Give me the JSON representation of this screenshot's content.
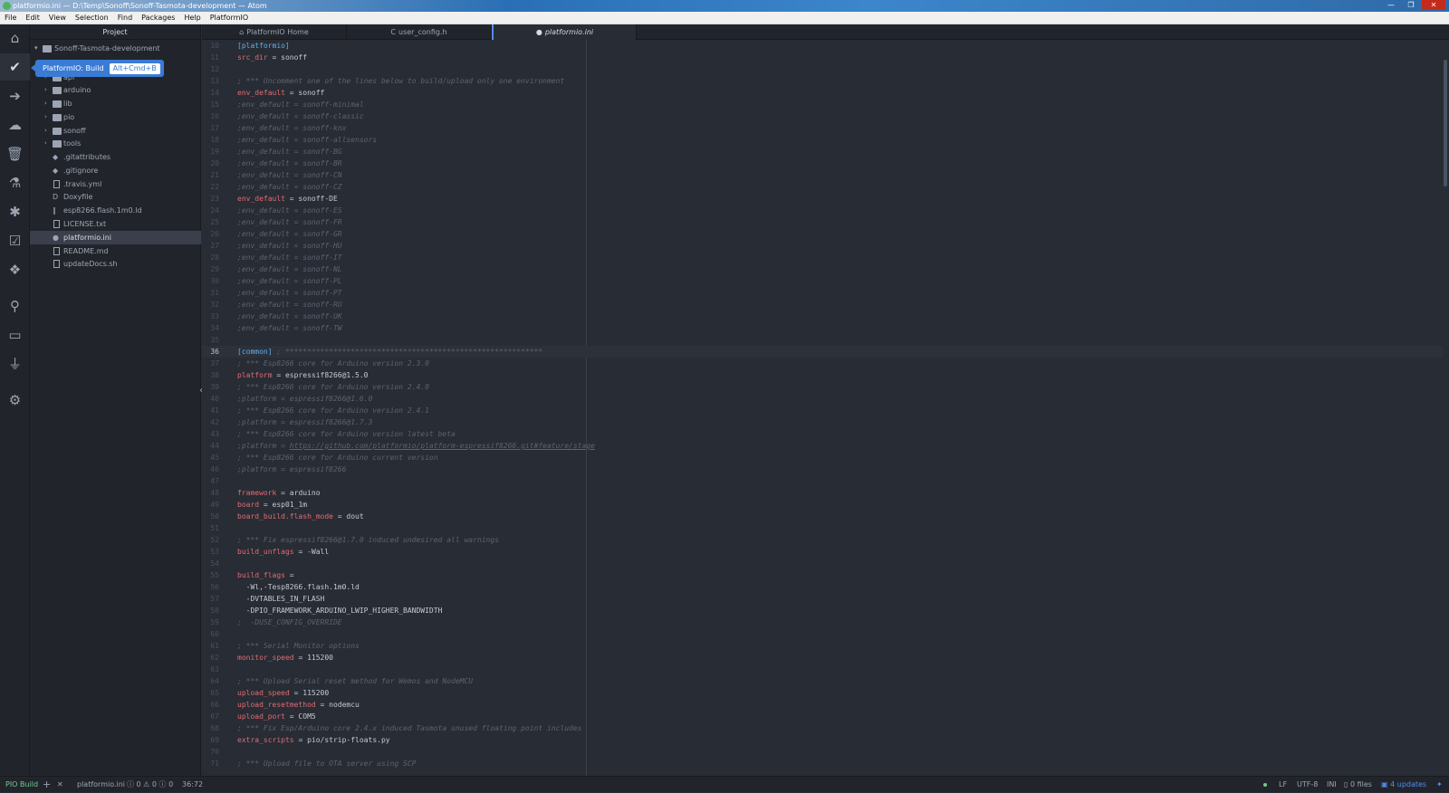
{
  "window": {
    "title": "platformio.ini — D:\\Temp\\Sonoff\\Sonoff-Tasmota-development — Atom",
    "controls": [
      "—",
      "❐",
      "✕"
    ]
  },
  "menu": [
    "File",
    "Edit",
    "View",
    "Selection",
    "Find",
    "Packages",
    "Help",
    "PlatformIO"
  ],
  "tooltip": {
    "label": "PlatformIO: Build",
    "shortcut": "Alt+Cmd+B"
  },
  "tree": {
    "header": "Project",
    "root": "Sonoff-Tasmota-development",
    "folders": [
      "api",
      "arduino",
      "lib",
      "pio",
      "sonoff",
      "tools"
    ],
    "files": [
      ".gitattributes",
      ".gitignore",
      ".travis.yml",
      "Doxyfile",
      "esp8266.flash.1m0.ld",
      "LICENSE.txt",
      "platformio.ini",
      "README.md",
      "updateDocs.sh"
    ]
  },
  "tabs": [
    {
      "label": "PlatformIO Home",
      "icon": "⌂"
    },
    {
      "label": "user_config.h",
      "icon": "C"
    },
    {
      "label": "platformio.ini",
      "icon": "●"
    }
  ],
  "editor": {
    "cursor_line": 36,
    "lines": [
      {
        "n": "10",
        "t": [
          [
            "sec",
            "[platformio]"
          ]
        ]
      },
      {
        "n": "11",
        "t": [
          [
            "key",
            "src_dir"
          ],
          [
            "val",
            " = sonoff"
          ]
        ]
      },
      {
        "n": "12",
        "t": []
      },
      {
        "n": "13",
        "t": [
          [
            "cmt",
            "; *** Uncomment one of the lines below to build/upload only one environment"
          ]
        ]
      },
      {
        "n": "14",
        "t": [
          [
            "key",
            "env_default"
          ],
          [
            "val",
            " = sonoff"
          ]
        ]
      },
      {
        "n": "15",
        "t": [
          [
            "cmt",
            ";env_default = sonoff-minimal"
          ]
        ]
      },
      {
        "n": "16",
        "t": [
          [
            "cmt",
            ";env_default = sonoff-classic"
          ]
        ]
      },
      {
        "n": "17",
        "t": [
          [
            "cmt",
            ";env_default = sonoff-knx"
          ]
        ]
      },
      {
        "n": "18",
        "t": [
          [
            "cmt",
            ";env_default = sonoff-allsensors"
          ]
        ]
      },
      {
        "n": "19",
        "t": [
          [
            "cmt",
            ";env_default = sonoff-BG"
          ]
        ]
      },
      {
        "n": "20",
        "t": [
          [
            "cmt",
            ";env_default = sonoff-BR"
          ]
        ]
      },
      {
        "n": "21",
        "t": [
          [
            "cmt",
            ";env_default = sonoff-CN"
          ]
        ]
      },
      {
        "n": "22",
        "t": [
          [
            "cmt",
            ";env_default = sonoff-CZ"
          ]
        ]
      },
      {
        "n": "23",
        "t": [
          [
            "key",
            "env_default"
          ],
          [
            "val",
            " = sonoff-DE"
          ]
        ]
      },
      {
        "n": "24",
        "t": [
          [
            "cmt",
            ";env_default = sonoff-ES"
          ]
        ]
      },
      {
        "n": "25",
        "t": [
          [
            "cmt",
            ";env_default = sonoff-FR"
          ]
        ]
      },
      {
        "n": "26",
        "t": [
          [
            "cmt",
            ";env_default = sonoff-GR"
          ]
        ]
      },
      {
        "n": "27",
        "t": [
          [
            "cmt",
            ";env_default = sonoff-HU"
          ]
        ]
      },
      {
        "n": "28",
        "t": [
          [
            "cmt",
            ";env_default = sonoff-IT"
          ]
        ]
      },
      {
        "n": "29",
        "t": [
          [
            "cmt",
            ";env_default = sonoff-NL"
          ]
        ]
      },
      {
        "n": "30",
        "t": [
          [
            "cmt",
            ";env_default = sonoff-PL"
          ]
        ]
      },
      {
        "n": "31",
        "t": [
          [
            "cmt",
            ";env_default = sonoff-PT"
          ]
        ]
      },
      {
        "n": "32",
        "t": [
          [
            "cmt",
            ";env_default = sonoff-RU"
          ]
        ]
      },
      {
        "n": "33",
        "t": [
          [
            "cmt",
            ";env_default = sonoff-UK"
          ]
        ]
      },
      {
        "n": "34",
        "t": [
          [
            "cmt",
            ";env_default = sonoff-TW"
          ]
        ]
      },
      {
        "n": "35",
        "t": []
      },
      {
        "n": "36",
        "t": [
          [
            "sec",
            "[common]"
          ],
          [
            "cmt",
            " ; ***********************************************************"
          ]
        ]
      },
      {
        "n": "37",
        "t": [
          [
            "cmt",
            "; *** Esp8266 core for Arduino version 2.3.0"
          ]
        ]
      },
      {
        "n": "38",
        "t": [
          [
            "key",
            "platform"
          ],
          [
            "val",
            " = espressif8266@1.5.0"
          ]
        ]
      },
      {
        "n": "39",
        "t": [
          [
            "cmt",
            "; *** Esp8266 core for Arduino version 2.4.0"
          ]
        ]
      },
      {
        "n": "40",
        "t": [
          [
            "cmt",
            ";platform = espressif8266@1.6.0"
          ]
        ]
      },
      {
        "n": "41",
        "t": [
          [
            "cmt",
            "; *** Esp8266 core for Arduino version 2.4.1"
          ]
        ]
      },
      {
        "n": "42",
        "t": [
          [
            "cmt",
            ";platform = espressif8266@1.7.3"
          ]
        ]
      },
      {
        "n": "43",
        "t": [
          [
            "cmt",
            "; *** Esp8266 core for Arduino version latest beta"
          ]
        ]
      },
      {
        "n": "44",
        "t": [
          [
            "cmt",
            ";platform = "
          ],
          [
            "link",
            "https://github.com/platformio/platform-espressif8266.git#feature/stage"
          ]
        ]
      },
      {
        "n": "45",
        "t": [
          [
            "cmt",
            "; *** Esp8266 core for Arduino current version"
          ]
        ]
      },
      {
        "n": "46",
        "t": [
          [
            "cmt",
            ";platform = espressif8266"
          ]
        ]
      },
      {
        "n": "47",
        "t": []
      },
      {
        "n": "48",
        "t": [
          [
            "key",
            "framework"
          ],
          [
            "val",
            " = arduino"
          ]
        ]
      },
      {
        "n": "49",
        "t": [
          [
            "key",
            "board"
          ],
          [
            "val",
            " = esp01_1m"
          ]
        ]
      },
      {
        "n": "50",
        "t": [
          [
            "key",
            "board_build.flash_mode"
          ],
          [
            "val",
            " = dout"
          ]
        ]
      },
      {
        "n": "51",
        "t": []
      },
      {
        "n": "52",
        "t": [
          [
            "cmt",
            "; *** Fix espressif8266@1.7.0 induced undesired all warnings"
          ]
        ]
      },
      {
        "n": "53",
        "t": [
          [
            "key",
            "build_unflags"
          ],
          [
            "val",
            " = -Wall"
          ]
        ]
      },
      {
        "n": "54",
        "t": []
      },
      {
        "n": "55",
        "t": [
          [
            "key",
            "build_flags"
          ],
          [
            "val",
            " ="
          ]
        ]
      },
      {
        "n": "56",
        "t": [
          [
            "val",
            "  -Wl,-Tesp8266.flash.1m0.ld"
          ]
        ]
      },
      {
        "n": "57",
        "t": [
          [
            "val",
            "  -DVTABLES_IN_FLASH"
          ]
        ]
      },
      {
        "n": "58",
        "t": [
          [
            "val",
            "  -DPIO_FRAMEWORK_ARDUINO_LWIP_HIGHER_BANDWIDTH"
          ]
        ]
      },
      {
        "n": "59",
        "t": [
          [
            "cmt",
            ";  -DUSE_CONFIG_OVERRIDE"
          ]
        ]
      },
      {
        "n": "60",
        "t": []
      },
      {
        "n": "61",
        "t": [
          [
            "cmt",
            "; *** Serial Monitor options"
          ]
        ]
      },
      {
        "n": "62",
        "t": [
          [
            "key",
            "monitor_speed"
          ],
          [
            "val",
            " = 115200"
          ]
        ]
      },
      {
        "n": "63",
        "t": []
      },
      {
        "n": "64",
        "t": [
          [
            "cmt",
            "; *** Upload Serial reset method for Wemos and NodeMCU"
          ]
        ]
      },
      {
        "n": "65",
        "t": [
          [
            "key",
            "upload_speed"
          ],
          [
            "val",
            " = 115200"
          ]
        ]
      },
      {
        "n": "66",
        "t": [
          [
            "key",
            "upload_resetmethod"
          ],
          [
            "val",
            " = nodemcu"
          ]
        ]
      },
      {
        "n": "67",
        "t": [
          [
            "key",
            "upload_port"
          ],
          [
            "val",
            " = COM5"
          ]
        ]
      },
      {
        "n": "68",
        "t": [
          [
            "cmt",
            "; *** Fix Esp/Arduino core 2.4.x induced Tasmota unused floating point includes"
          ]
        ]
      },
      {
        "n": "69",
        "t": [
          [
            "key",
            "extra_scripts"
          ],
          [
            "val",
            " = pio/strip-floats.py"
          ]
        ]
      },
      {
        "n": "70",
        "t": []
      },
      {
        "n": "71",
        "t": [
          [
            "cmt",
            "; *** Upload file to OTA server using SCP"
          ]
        ]
      }
    ]
  },
  "status": {
    "pio_build": "PIO Build",
    "add": "+",
    "close": "✕",
    "file": "platformio.ini",
    "problems": "ⓘ 0 ⚠ 0 ⓘ 0",
    "cursor": "36:72",
    "line_ending": "LF",
    "encoding": "UTF-8",
    "grammar": "INI",
    "files": "0 files",
    "updates": "4 updates"
  },
  "colors": {
    "accent": "#568af2",
    "tooltip": "#3a7bd5",
    "section": "#61afef",
    "key": "#e06c75"
  }
}
